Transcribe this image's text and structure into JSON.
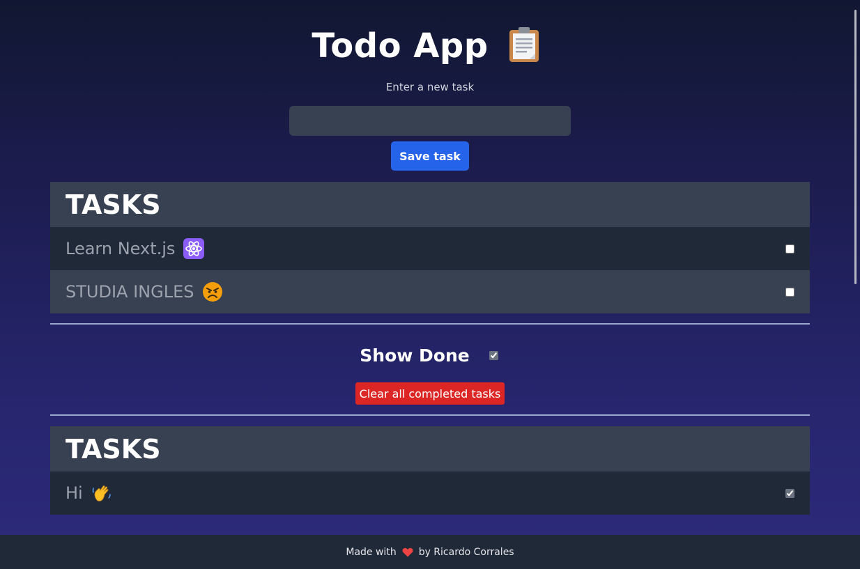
{
  "header": {
    "title": "Todo App",
    "title_icon": "clipboard-icon"
  },
  "new_task": {
    "label": "Enter a new task",
    "value": "",
    "placeholder": "",
    "save_label": "Save task"
  },
  "pending_panel": {
    "heading": "TASKS",
    "items": [
      {
        "text": "Learn Next.js",
        "emoji": "atom-icon",
        "done": false
      },
      {
        "text": "STUDIA INGLES",
        "emoji": "angry-face-icon",
        "done": false
      }
    ]
  },
  "controls": {
    "show_done_label": "Show Done",
    "show_done_checked": true,
    "clear_label": "Clear all completed tasks"
  },
  "done_panel": {
    "heading": "TASKS",
    "items": [
      {
        "text": "Hi",
        "emoji": "waving-hand-icon",
        "done": true
      }
    ]
  },
  "footer": {
    "prefix": "Made with",
    "heart_icon": "heart-icon",
    "suffix": "by Ricardo Corrales"
  },
  "colors": {
    "primary_button": "#2563eb",
    "danger_button": "#dc2626",
    "panel_header": "#374151",
    "row_dark": "#1f2937"
  }
}
